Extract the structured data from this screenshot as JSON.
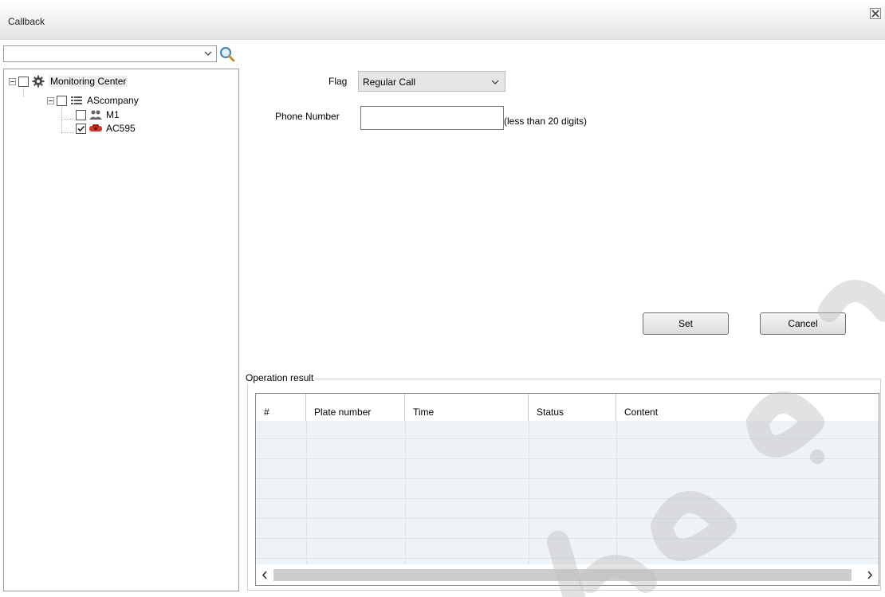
{
  "window": {
    "title": "Callback"
  },
  "tree": {
    "nodes": [
      {
        "label": "Monitoring Center",
        "checked": false,
        "icon": "gear-icon"
      },
      {
        "label": "AScompany",
        "checked": false,
        "icon": "list-icon"
      },
      {
        "label": "M1",
        "checked": false,
        "icon": "users-icon"
      },
      {
        "label": "AC595",
        "checked": true,
        "icon": "car-icon"
      }
    ]
  },
  "form": {
    "flag_label": "Flag",
    "flag_value": "Regular Call",
    "phone_label": "Phone Number",
    "phone_value": "",
    "phone_hint": "(less than 20 digits)"
  },
  "buttons": {
    "set": "Set",
    "cancel": "Cancel"
  },
  "result": {
    "group_title": "Operation result",
    "columns": [
      "#",
      "Plate number",
      "Time",
      "Status",
      "Content"
    ],
    "rows": []
  },
  "colors": {
    "grid_body": "#eef3f7",
    "car_red": "#d33a2c",
    "titlebar": "#e2e2e2"
  }
}
